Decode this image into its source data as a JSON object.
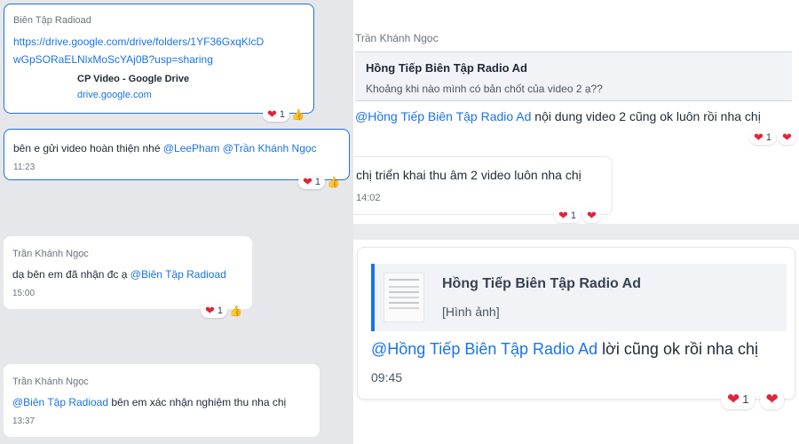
{
  "left": {
    "msg1": {
      "sender": "Biên Tập Radioad",
      "link_line1": "https://drive.google.com/drive/folders/1YF36GxqKlcD",
      "link_line2": "wGpSORaELNlxMoScYAj0B?usp=sharing",
      "preview_title": "CP Video - Google Drive",
      "preview_domain": "drive.google.com",
      "react_count": "1"
    },
    "msg2": {
      "text_plain": "bên e gửi video hoàn thiện nhé ",
      "mention1": "@LeePham",
      "mention2": "@Trần Khánh Ngọc",
      "time": "11:23",
      "react_count": "1"
    },
    "msg3": {
      "sender": "Trần Khánh Ngọc",
      "text_plain": "dạ bên em đã nhận đc ạ ",
      "mention": "@Biên Tập Radioad",
      "time": "15:00",
      "react_count": "1"
    },
    "msg4": {
      "sender": "Trần Khánh Ngọc",
      "mention": "@Biên Tập Radioad",
      "text_plain": " bên em xác nhận nghiệm thu nha chị",
      "time": "13:37"
    }
  },
  "right": {
    "sender": "Trần Khánh Ngọc",
    "msg1": {
      "quote_author": "Hồng Tiếp Biên Tập Radio Ad",
      "quote_text": "Khoảng khi nào mình có bản chốt của video 2 ạ??",
      "mention": "@Hồng Tiếp Biên Tập Radio Ad",
      "text_plain": " nội dung video 2 cũng ok luôn rồi nha chị",
      "react_count": "1"
    },
    "msg2": {
      "text": "chị triển khai thu âm 2 video luôn nha chị",
      "time": "14:02",
      "react_count": "1"
    },
    "msg3": {
      "quote_author": "Hồng Tiếp Biên Tập Radio Ad",
      "quote_text": "[Hình ảnh]",
      "mention": "@Hồng Tiếp Biên Tập Radio Ad",
      "text_plain": " lời cũng ok rồi nha chị",
      "time": "09:45",
      "react_count": "1"
    }
  },
  "colors": {
    "accent": "#1a73e8",
    "heart": "#e0243a",
    "border_me": "#1f6fe5"
  }
}
